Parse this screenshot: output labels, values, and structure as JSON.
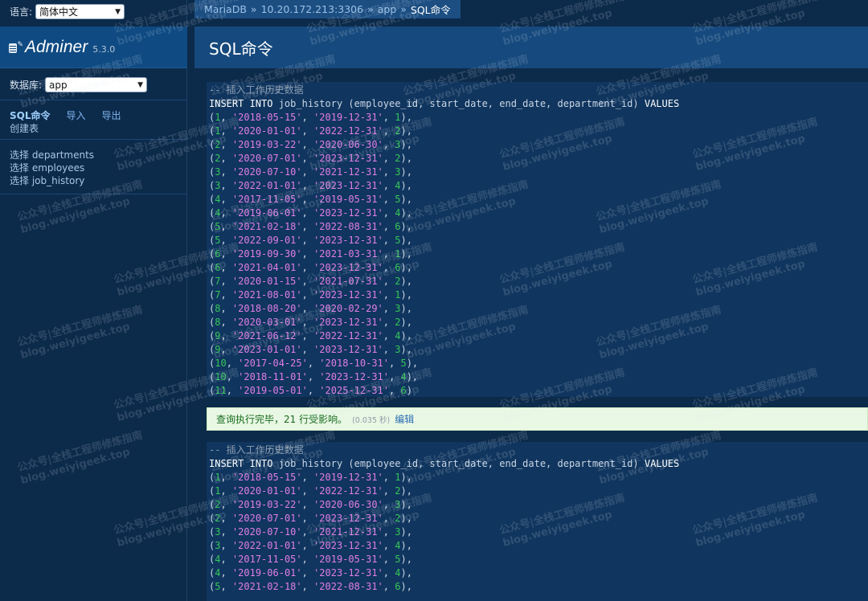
{
  "sidebar": {
    "language_label": "语言:",
    "language_value": "简体中文",
    "logo_text": "Adminer",
    "version": "5.3.0",
    "db_label": "数据库:",
    "db_value": "app",
    "links": [
      "SQL命令",
      "导入",
      "导出"
    ],
    "create_table": "创建表",
    "tables": [
      "选择 departments",
      "选择 employees",
      "选择 job_history"
    ]
  },
  "breadcrumb": {
    "parts": [
      "MariaDB",
      "10.20.172.213:3306",
      "app"
    ],
    "current": "SQL命令",
    "separator": "»"
  },
  "page_title": "SQL命令",
  "query": {
    "comment": "-- 插入工作历史数据",
    "insert_kw": "INSERT INTO",
    "table": "job_history",
    "columns": "(employee_id, start_date, end_date, department_id)",
    "values_kw": "VALUES",
    "rows": [
      [
        "1",
        "'2018-05-15'",
        "'2019-12-31'",
        "1"
      ],
      [
        "1",
        "'2020-01-01'",
        "'2022-12-31'",
        "2"
      ],
      [
        "2",
        "'2019-03-22'",
        "'2020-06-30'",
        "3"
      ],
      [
        "2",
        "'2020-07-01'",
        "'2023-12-31'",
        "2"
      ],
      [
        "3",
        "'2020-07-10'",
        "'2021-12-31'",
        "3"
      ],
      [
        "3",
        "'2022-01-01'",
        "'2023-12-31'",
        "4"
      ],
      [
        "4",
        "'2017-11-05'",
        "'2019-05-31'",
        "5"
      ],
      [
        "4",
        "'2019-06-01'",
        "'2023-12-31'",
        "4"
      ],
      [
        "5",
        "'2021-02-18'",
        "'2022-08-31'",
        "6"
      ],
      [
        "5",
        "'2022-09-01'",
        "'2023-12-31'",
        "5"
      ],
      [
        "6",
        "'2019-09-30'",
        "'2021-03-31'",
        "1"
      ],
      [
        "6",
        "'2021-04-01'",
        "'2023-12-31'",
        "6"
      ],
      [
        "7",
        "'2020-01-15'",
        "'2021-07-31'",
        "2"
      ],
      [
        "7",
        "'2021-08-01'",
        "'2023-12-31'",
        "1"
      ],
      [
        "8",
        "'2018-08-20'",
        "'2020-02-29'",
        "3"
      ],
      [
        "8",
        "'2020-03-01'",
        "'2023-12-31'",
        "2"
      ],
      [
        "9",
        "'2021-06-12'",
        "'2022-12-31'",
        "4"
      ],
      [
        "9",
        "'2023-01-01'",
        "'2023-12-31'",
        "3"
      ],
      [
        "10",
        "'2017-04-25'",
        "'2018-10-31'",
        "5"
      ],
      [
        "10",
        "'2018-11-01'",
        "'2023-12-31'",
        "4"
      ],
      [
        "11",
        "'2019-05-01'",
        "'2025-12-31'",
        "6"
      ]
    ],
    "rows_second_block_visible": 9
  },
  "message": {
    "text": "查询执行完毕，21 行受影响。",
    "time": "(0.035 秒)",
    "edit": "编辑"
  },
  "watermark": {
    "line1": "公众号|全栈工程师修炼指南",
    "line2": "blog.weiyigeek.top"
  },
  "colors": {
    "background": "#0c2a4a",
    "header_blue": "#16497d",
    "code_bg": "#10355e",
    "number": "#34c759",
    "string": "#e07ee6",
    "message_bg": "#e9f8e4"
  }
}
